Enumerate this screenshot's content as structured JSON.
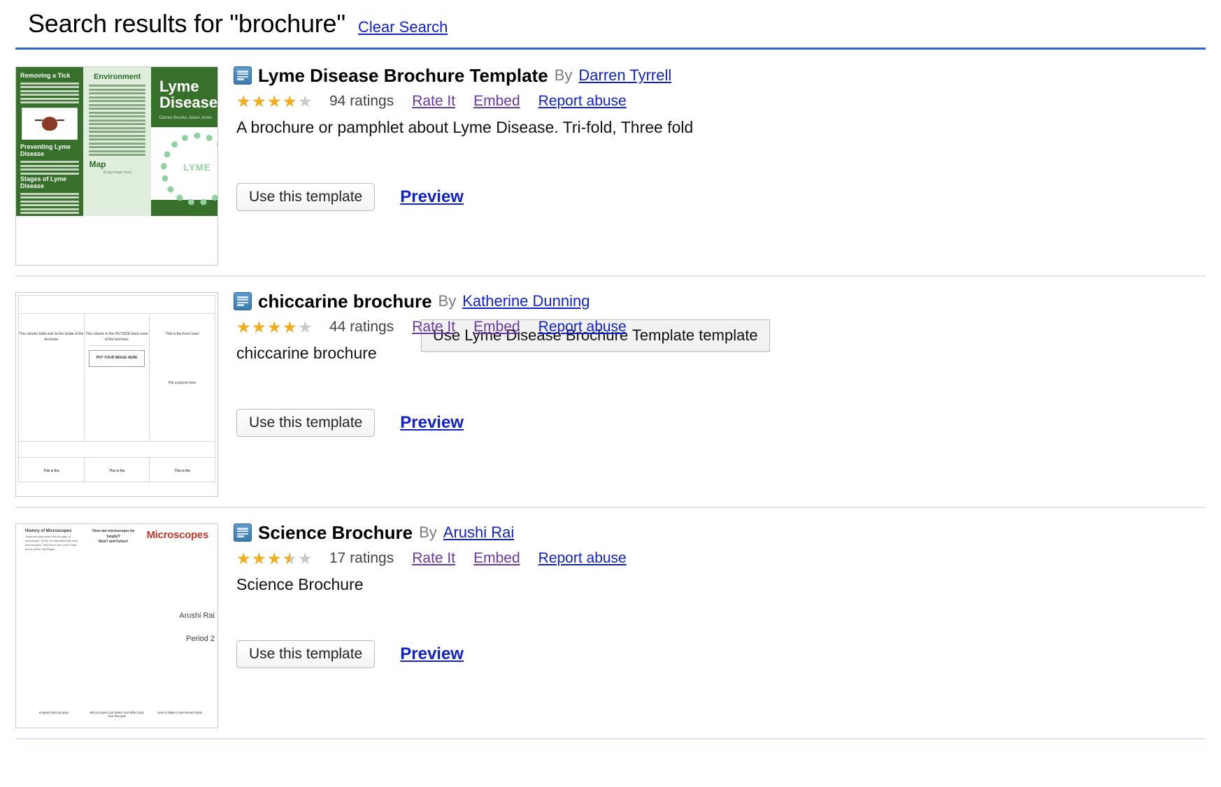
{
  "header": {
    "title": "Search results for \"brochure\"",
    "clear_search_label": "Clear Search",
    "rule_color": "#3366cc"
  },
  "labels": {
    "by": "By",
    "use_button": "Use this template",
    "preview": "Preview",
    "rate_it": "Rate It",
    "embed": "Embed",
    "report_abuse": "Report abuse"
  },
  "colors": {
    "link_fresh": "#1122cc",
    "link_visited": "#6a3a9e",
    "star_filled": "#f0ad1e",
    "star_empty": "#c9c9c9",
    "accent_rule": "#3366cc"
  },
  "tooltip": {
    "visible": true,
    "text": "Use Lyme Disease Brochure Template template"
  },
  "results": [
    {
      "title": "Lyme Disease Brochure Template",
      "author": "Darren Tyrrell",
      "rating": 4,
      "rating_label": "94 ratings",
      "ratings_count": 94,
      "description": "A brochure or pamphlet about Lyme Disease. Tri-fold, Three fold",
      "icon": "document-icon",
      "thumbnail": {
        "kind": "lyme-trifold",
        "col1_heading": "Removing a Tick",
        "col1_heading2": "Preventing Lyme Disease",
        "col1_heading3": "Stages of Lyme Disease",
        "col2_heading": "Environment",
        "col2_map_word": "Map",
        "col2_map_note": "[Drag image here]",
        "col3_title": "Lyme Disease",
        "col3_subtitle": "Darren Bourke, Adam Jones",
        "seal_text": "LYME"
      }
    },
    {
      "title": "chiccarine brochure",
      "author": "Katherine Dunning",
      "rating": 4,
      "rating_label": "44 ratings",
      "ratings_count": 44,
      "description": "chiccarine brochure",
      "icon": "document-icon",
      "thumbnail": {
        "kind": "blank-trifold",
        "col1_text": "This column folds over to the inside of the brochure",
        "col2_text": "This column is the OUTSIDE back cover of the brochure",
        "photo_text": "PUT YOUR IMAGE HERE",
        "col3_text": "This is the front cover",
        "col3_note": "Put a picture here",
        "foot1": "This is the",
        "foot2": "This is the",
        "foot3": "This is the"
      }
    },
    {
      "title": "Science Brochure",
      "author": "Arushi Rai",
      "rating": 3.5,
      "rating_label": "17 ratings",
      "ratings_count": 17,
      "description": "Science Brochure",
      "icon": "document-icon",
      "thumbnail": {
        "kind": "science-trifold",
        "col1_heading": "History of Microscopes",
        "col1_body": "Someone discovered the first type of microscope. At the, for centuries they used microscopes. They found out a cell it was, and a closer it all began.",
        "col2_heading": "How can microscopes be helpful?",
        "col2_sub": "Now? and Future!",
        "col3_title": "Microscopes",
        "name": "Arushi Rai",
        "period": "Period 2",
        "foot1": "Inspired Microscopes",
        "foot2": "Microscopes can detect and affect and how the past",
        "foot3": "How to Make a Wet Mount Slide"
      }
    }
  ]
}
